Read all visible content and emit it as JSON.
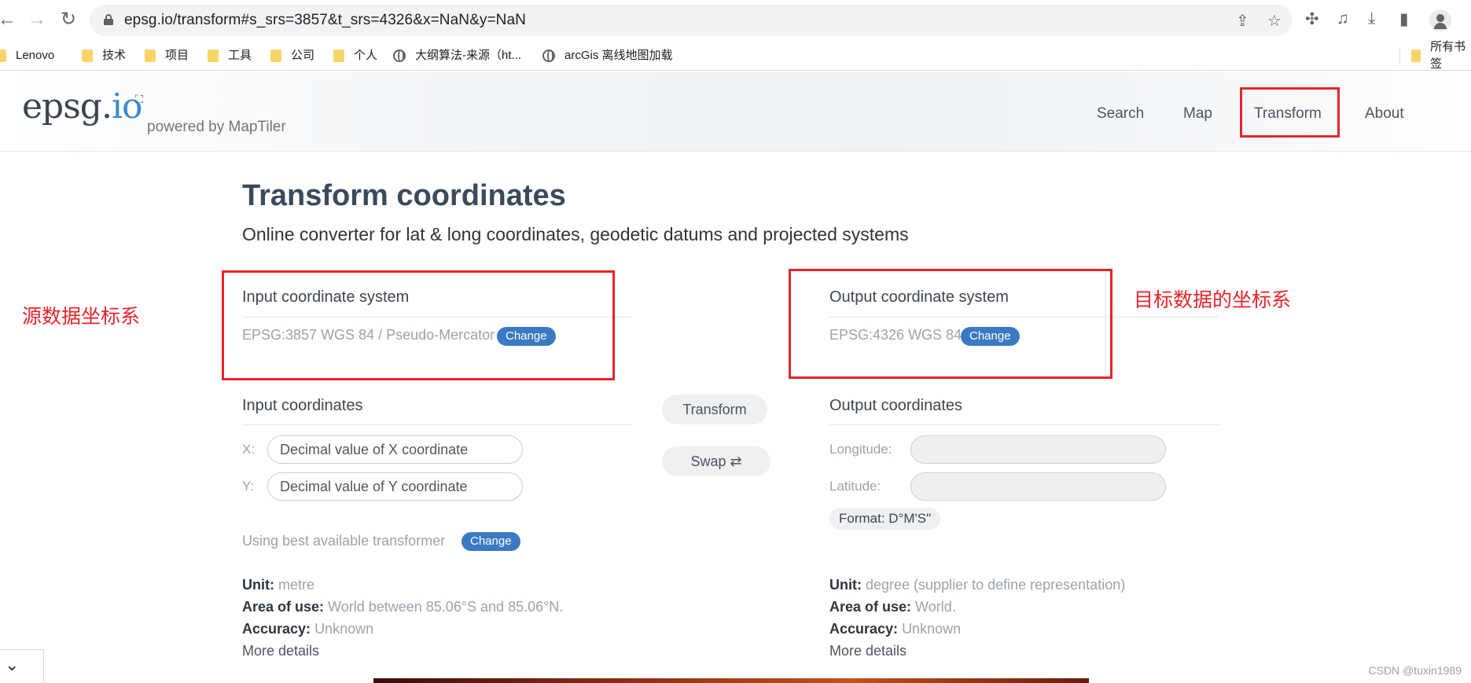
{
  "browser": {
    "url": "epsg.io/transform#s_srs=3857&t_srs=4326&x=NaN&y=NaN",
    "bookmarks": [
      {
        "label": "Lenovo",
        "kind": "folder"
      },
      {
        "label": "技术",
        "kind": "folder"
      },
      {
        "label": "项目",
        "kind": "folder"
      },
      {
        "label": "工具",
        "kind": "folder"
      },
      {
        "label": "公司",
        "kind": "folder"
      },
      {
        "label": "个人",
        "kind": "folder"
      },
      {
        "label": "大纲算法-来源（ht...",
        "kind": "globe"
      },
      {
        "label": "arcGis 离线地图加载",
        "kind": "globe"
      }
    ],
    "all_bookmarks_label": "所有书签"
  },
  "site": {
    "logo_main": "epsg.",
    "logo_io": "io",
    "powered_by": "powered by MapTiler",
    "nav": [
      "Search",
      "Map",
      "Transform",
      "About"
    ]
  },
  "page": {
    "title": "Transform coordinates",
    "subtitle": "Online converter for lat & long coordinates, geodetic datums and projected systems"
  },
  "input": {
    "system_title": "Input coordinate system",
    "system_value": "EPSG:3857 WGS 84 / Pseudo-Mercator",
    "change_label": "Change",
    "coords_title": "Input coordinates",
    "x_label": "X:",
    "y_label": "Y:",
    "x_placeholder": "Decimal value of X coordinate",
    "y_placeholder": "Decimal value of Y coordinate",
    "transformer_text": "Using best available transformer",
    "transformer_change": "Change",
    "unit_label": "Unit:",
    "unit_value": "metre",
    "area_label": "Area of use:",
    "area_value": "World between 85.06°S and 85.06°N.",
    "accuracy_label": "Accuracy:",
    "accuracy_value": "Unknown",
    "more_details": "More details"
  },
  "actions": {
    "transform": "Transform",
    "swap": "Swap ⇄"
  },
  "output": {
    "system_title": "Output coordinate system",
    "system_value": "EPSG:4326 WGS 84",
    "change_label": "Change",
    "coords_title": "Output coordinates",
    "longitude_label": "Longitude:",
    "latitude_label": "Latitude:",
    "longitude_value": "",
    "latitude_value": "",
    "format_label": "Format: D°M'S\"",
    "unit_label": "Unit:",
    "unit_value": "degree (supplier to define representation)",
    "area_label": "Area of use:",
    "area_value": "World.",
    "accuracy_label": "Accuracy:",
    "accuracy_value": "Unknown",
    "more_details": "More details"
  },
  "annotations": {
    "source_label": "源数据坐标系",
    "target_label": "目标数据的坐标系",
    "color": "#e8242b"
  },
  "watermark": "CSDN @tuxin1989"
}
